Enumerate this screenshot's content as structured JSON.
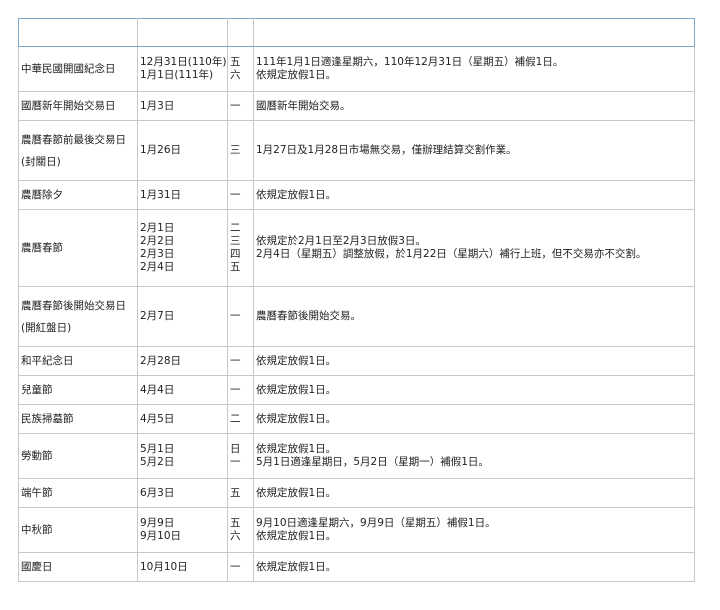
{
  "table": {
    "headers": [
      "",
      "",
      "",
      ""
    ],
    "rows": [
      {
        "name": [
          "中華民國開國紀念日"
        ],
        "dates": [
          "12月31日(110年)",
          "1月1日(111年)"
        ],
        "weekdays": [
          "五",
          "六"
        ],
        "notes": [
          "111年1月1日適逢星期六，110年12月31日（星期五）補假1日。",
          "依規定放假1日。"
        ]
      },
      {
        "name": [
          "國曆新年開始交易日"
        ],
        "dates": [
          "1月3日"
        ],
        "weekdays": [
          "一"
        ],
        "notes": [
          "國曆新年開始交易。"
        ]
      },
      {
        "name": [
          "農曆春節前最後交易日",
          "(封關日)"
        ],
        "dates": [
          "1月26日"
        ],
        "weekdays": [
          "三"
        ],
        "notes": [
          "1月27日及1月28日市場無交易，僅辦理結算交割作業。"
        ]
      },
      {
        "name": [
          "農曆除夕"
        ],
        "dates": [
          "1月31日"
        ],
        "weekdays": [
          "一"
        ],
        "notes": [
          "依規定放假1日。"
        ]
      },
      {
        "name": [
          "農曆春節"
        ],
        "dates": [
          "2月1日",
          "2月2日",
          "2月3日",
          "2月4日"
        ],
        "weekdays": [
          "二",
          "三",
          "四",
          "五"
        ],
        "notes": [
          "依規定於2月1日至2月3日放假3日。",
          "2月4日（星期五）調整放假，於1月22日（星期六）補行上班，但不交易亦不交割。"
        ]
      },
      {
        "name": [
          "農曆春節後開始交易日",
          "(開紅盤日)"
        ],
        "dates": [
          "2月7日"
        ],
        "weekdays": [
          "一"
        ],
        "notes": [
          "農曆春節後開始交易。"
        ]
      },
      {
        "name": [
          "和平紀念日"
        ],
        "dates": [
          "2月28日"
        ],
        "weekdays": [
          "一"
        ],
        "notes": [
          "依規定放假1日。"
        ]
      },
      {
        "name": [
          "兒童節"
        ],
        "dates": [
          "4月4日"
        ],
        "weekdays": [
          "一"
        ],
        "notes": [
          "依規定放假1日。"
        ]
      },
      {
        "name": [
          "民族掃墓節"
        ],
        "dates": [
          "4月5日"
        ],
        "weekdays": [
          "二"
        ],
        "notes": [
          "依規定放假1日。"
        ]
      },
      {
        "name": [
          "勞動節"
        ],
        "dates": [
          "5月1日",
          "5月2日"
        ],
        "weekdays": [
          "日",
          "一"
        ],
        "notes": [
          "依規定放假1日。",
          "5月1日適逢星期日，5月2日（星期一）補假1日。"
        ]
      },
      {
        "name": [
          "端午節"
        ],
        "dates": [
          "6月3日"
        ],
        "weekdays": [
          "五"
        ],
        "notes": [
          "依規定放假1日。"
        ]
      },
      {
        "name": [
          "中秋節"
        ],
        "dates": [
          "9月9日",
          "9月10日"
        ],
        "weekdays": [
          "五",
          "六"
        ],
        "notes": [
          "9月10日適逢星期六，9月9日（星期五）補假1日。",
          "依規定放假1日。"
        ]
      },
      {
        "name": [
          "國慶日"
        ],
        "dates": [
          "10月10日"
        ],
        "weekdays": [
          "一"
        ],
        "notes": [
          "依規定放假1日。"
        ]
      }
    ]
  }
}
